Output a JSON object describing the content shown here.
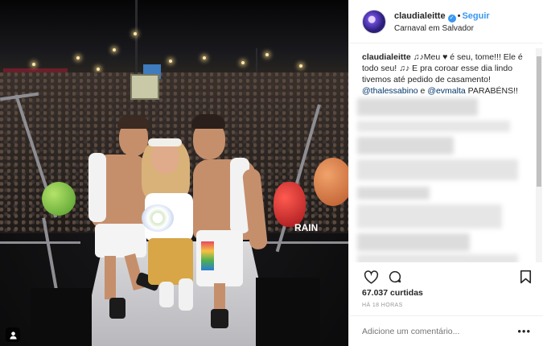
{
  "post": {
    "username": "claudialeitte",
    "follow_label": "Seguir",
    "location": "Carnaval em Salvador",
    "caption_user": "claudialeitte",
    "caption_part1": " ♫♪Meu ♥ é seu, tome!!! Ele é todo seu! ♫♪ E pra coroar esse dia lindo tivemos até pedido de casamento!",
    "mention1": "@thalessabino",
    "caption_and": " e ",
    "mention2": "@evmalta",
    "caption_part2": " PARABÉNS!!",
    "likes": "67.037 curtidas",
    "timestamp": "HÁ 18 HORAS",
    "comment_placeholder": "Adicione um comentário...",
    "more_label": "•••"
  },
  "photo": {
    "banner_text": "RAIN"
  },
  "icons": {
    "verified": "verified-badge-icon",
    "like": "heart-icon",
    "comment": "comment-icon",
    "save": "bookmark-icon",
    "tag": "user-tag-icon"
  },
  "colors": {
    "accent": "#3897f0",
    "mention": "#003569",
    "muted": "#999999"
  }
}
